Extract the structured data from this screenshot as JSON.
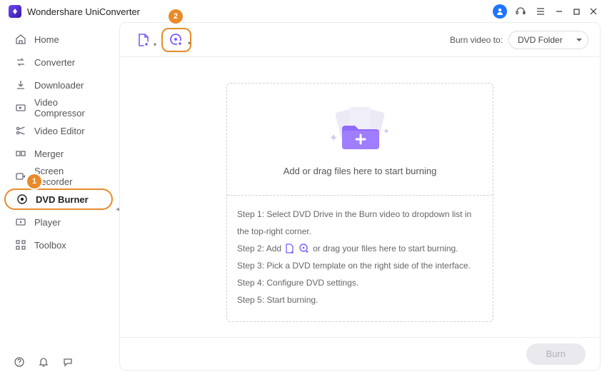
{
  "app": {
    "title": "Wondershare UniConverter"
  },
  "sidebar": {
    "items": [
      {
        "label": "Home"
      },
      {
        "label": "Converter"
      },
      {
        "label": "Downloader"
      },
      {
        "label": "Video Compressor"
      },
      {
        "label": "Video Editor"
      },
      {
        "label": "Merger"
      },
      {
        "label": "Screen Recorder"
      },
      {
        "label": "DVD Burner"
      },
      {
        "label": "Player"
      },
      {
        "label": "Toolbox"
      }
    ]
  },
  "toolbar": {
    "burn_to_label": "Burn video to:",
    "burn_to_selected": "DVD Folder"
  },
  "dropzone": {
    "title": "Add or drag files here to start burning",
    "steps": {
      "s1_pre": "Step 1: Select DVD Drive in the Burn video to dropdown list in the top-right corner.",
      "s2_pre": "Step 2: Add",
      "s2_post": "or drag your files here to start burning.",
      "s3": "Step 3: Pick a DVD template on the right side of the interface.",
      "s4": "Step 4: Configure DVD settings.",
      "s5": "Step 5: Start burning."
    }
  },
  "footer": {
    "burn_label": "Burn"
  },
  "annotations": {
    "badge1": "1",
    "badge2": "2"
  }
}
